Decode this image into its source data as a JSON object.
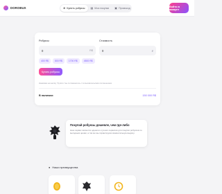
{
  "header": {
    "logo": "DOROBUX",
    "tabs": [
      {
        "label": "Купить робуксы",
        "icon": "cart-icon"
      },
      {
        "label": "Мои покупки",
        "icon": "list-icon"
      },
      {
        "label": "Промокод",
        "icon": "ticket-icon"
      }
    ],
    "signin_label": "Войти в аккаунт"
  },
  "purchase": {
    "robux_label": "Робуксы",
    "robux_value": "0",
    "robux_unit": "R$",
    "price_label": "Стоимость",
    "price_value": "0",
    "price_unit": "₽",
    "presets": [
      "400 R$",
      "800 R$",
      "1700 R$",
      "4500 R$"
    ],
    "buy_label": "Купить робуксы",
    "note": "Нажимая на кнопку \"Купить\" вы соглашаетесь с пользовательским соглашением",
    "stock_label": "В наличии:",
    "stock_value": "150 000 R$"
  },
  "promo": {
    "title": "Покупай робуксы дешевле, чем где-либо",
    "text": "Наш сервис является одним из лучших сервисов для покупки робуксов по выгодным ценам, а так же мы гарантируем моментальную выдачу."
  },
  "advantages": {
    "title": "Наши преимущества"
  },
  "colors": {
    "accent_start": "#ff4f96",
    "accent_end": "#8f5bff",
    "accent_text": "#7b5cff"
  }
}
